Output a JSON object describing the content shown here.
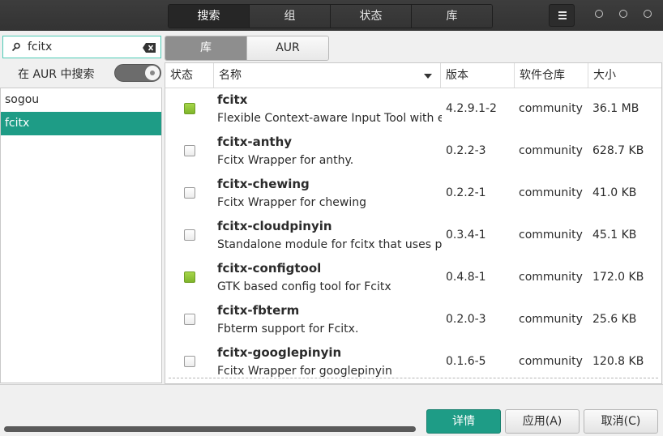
{
  "header": {
    "tabs": [
      {
        "label": "搜索",
        "active": true
      },
      {
        "label": "组",
        "active": false
      },
      {
        "label": "状态",
        "active": false
      },
      {
        "label": "库",
        "active": false
      }
    ],
    "menu_icon": "hamburger-icon"
  },
  "sidebar": {
    "search": {
      "value": "fcitx",
      "placeholder": ""
    },
    "aur_search_label": "在 AUR 中搜索",
    "aur_toggle_on": true,
    "history": [
      {
        "label": "sogou",
        "selected": false
      },
      {
        "label": "fcitx",
        "selected": true
      }
    ]
  },
  "repo_tabs": [
    {
      "label": "库",
      "active": true
    },
    {
      "label": "AUR",
      "active": false
    }
  ],
  "table": {
    "headers": {
      "status": "状态",
      "name": "名称",
      "version": "版本",
      "repo": "软件仓库",
      "size": "大小"
    },
    "rows": [
      {
        "installed": true,
        "name": "fcitx",
        "desc": "Flexible Context-aware Input Tool with eXtension",
        "version": "4.2.9.1-2",
        "repo": "community",
        "size": "36.1 MB"
      },
      {
        "installed": false,
        "name": "fcitx-anthy",
        "desc": "Fcitx Wrapper for anthy.",
        "version": "0.2.2-3",
        "repo": "community",
        "size": "628.7 KB"
      },
      {
        "installed": false,
        "name": "fcitx-chewing",
        "desc": "Fcitx Wrapper for chewing",
        "version": "0.2.2-1",
        "repo": "community",
        "size": "41.0 KB"
      },
      {
        "installed": false,
        "name": "fcitx-cloudpinyin",
        "desc": "Standalone module for fcitx that uses pinyin",
        "version": "0.3.4-1",
        "repo": "community",
        "size": "45.1 KB"
      },
      {
        "installed": true,
        "name": "fcitx-configtool",
        "desc": "GTK based config tool for Fcitx",
        "version": "0.4.8-1",
        "repo": "community",
        "size": "172.0 KB"
      },
      {
        "installed": false,
        "name": "fcitx-fbterm",
        "desc": "Fbterm support for Fcitx.",
        "version": "0.2.0-3",
        "repo": "community",
        "size": "25.6 KB"
      },
      {
        "installed": false,
        "name": "fcitx-googlepinyin",
        "desc": "Fcitx Wrapper for googlepinyin",
        "version": "0.1.6-5",
        "repo": "community",
        "size": "120.8 KB"
      }
    ]
  },
  "footer": {
    "details_label": "详情",
    "apply_label": "应用(A)",
    "cancel_label": "取消(C)"
  },
  "colors": {
    "accent": "#1e9c86",
    "installed": "#8cc63f",
    "header_bg": "#353535"
  }
}
